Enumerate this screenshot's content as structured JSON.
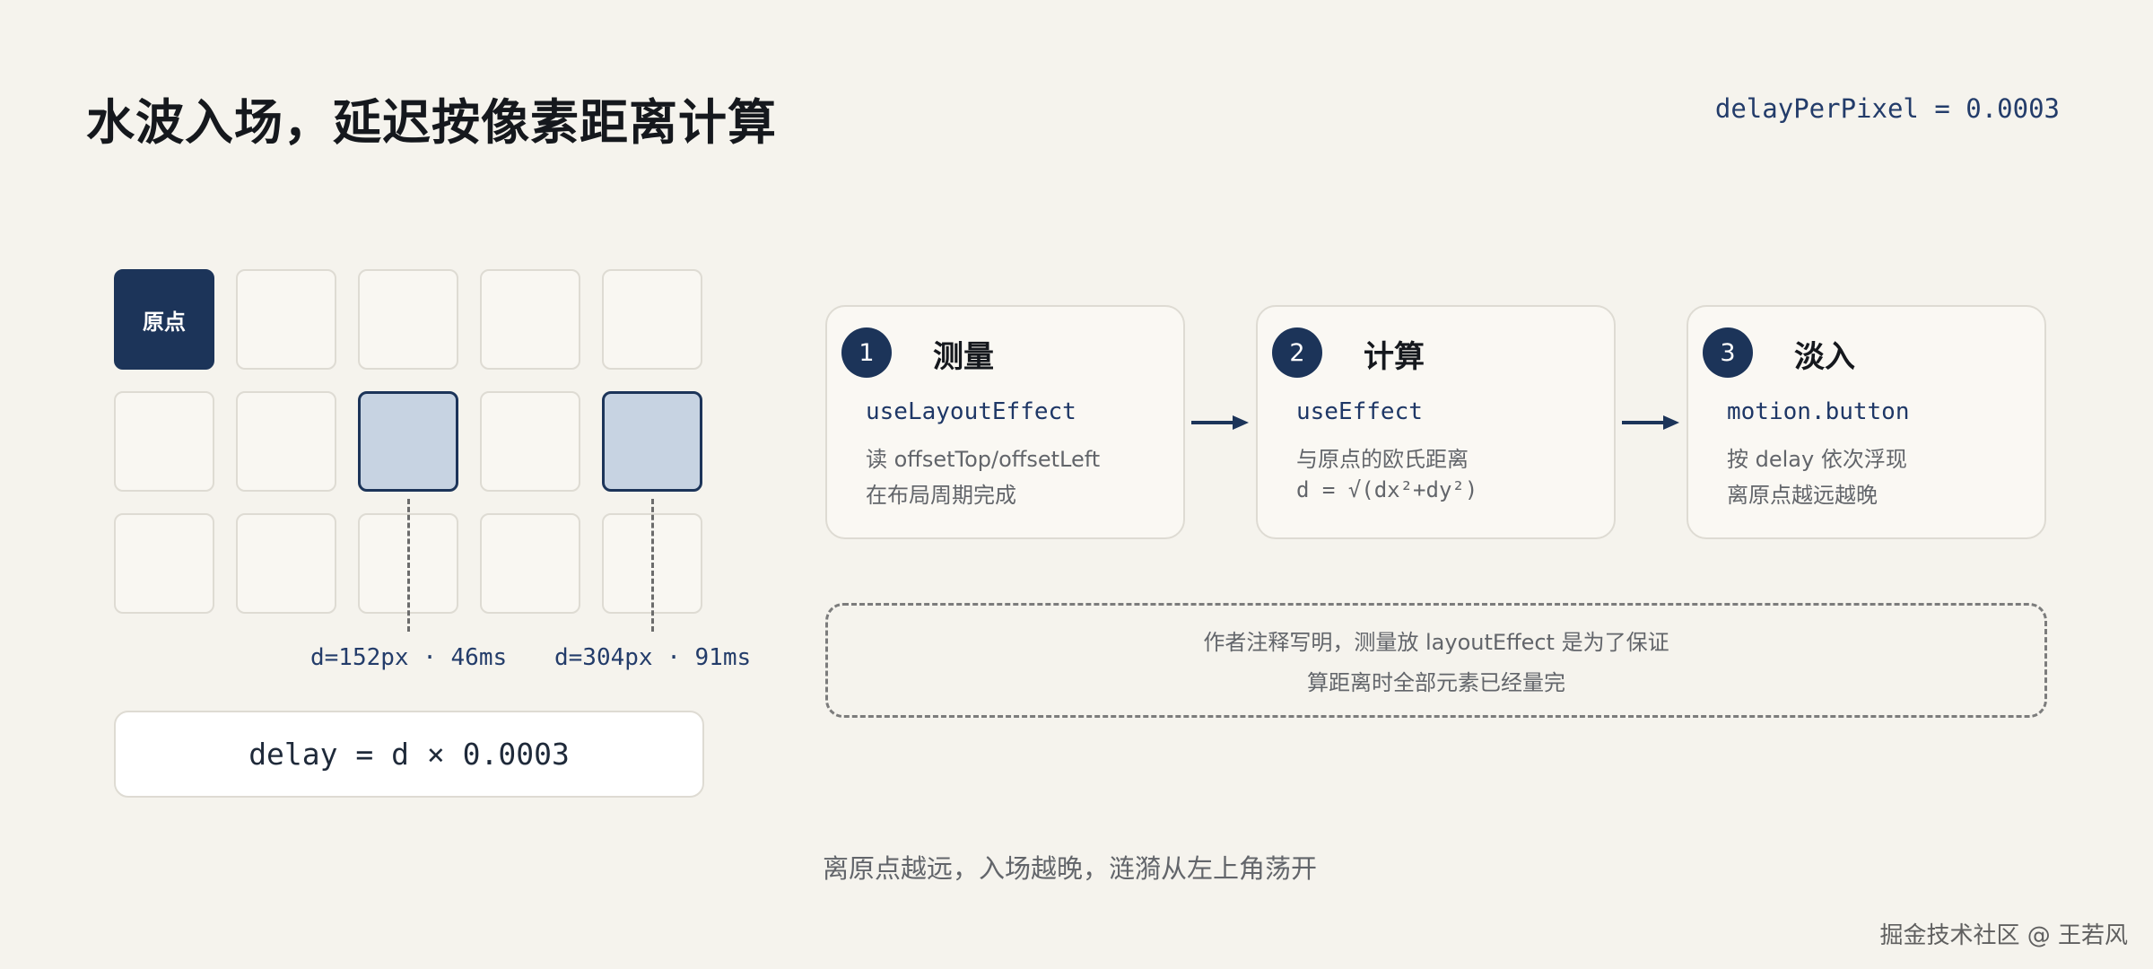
{
  "title": "水波入场，延迟按像素距离计算",
  "param_label": "delayPerPixel = 0.0003",
  "grid": {
    "origin_label": "原点",
    "distance_labels": [
      "d=152px · 46ms",
      "d=304px · 91ms"
    ],
    "formula": "delay = d × 0.0003"
  },
  "steps": [
    {
      "num": "1",
      "title": "测量",
      "code": "useLayoutEffect",
      "line1": "读 offsetTop/offsetLeft",
      "line2": "在布局周期完成"
    },
    {
      "num": "2",
      "title": "计算",
      "code": "useEffect",
      "line1": "与原点的欧氏距离",
      "line2": "d = √(dx²+dy²)"
    },
    {
      "num": "3",
      "title": "淡入",
      "code": "motion.button",
      "line1": "按 delay 依次浮现",
      "line2": "离原点越远越晚"
    }
  ],
  "note": {
    "line1": "作者注释写明，测量放 layoutEffect 是为了保证",
    "line2": "算距离时全部元素已经量完"
  },
  "caption": "离原点越远，入场越晚，涟漪从左上角荡开",
  "watermark": "掘金技术社区 @ 王若风",
  "colors": {
    "accent": "#1c3459",
    "highlight": "#c7d3e2",
    "background": "#f5f3ed"
  }
}
